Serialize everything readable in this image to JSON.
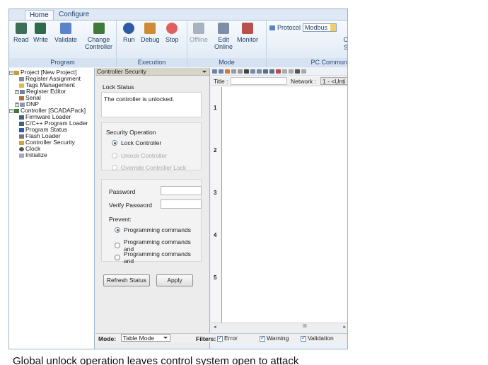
{
  "ribbon": {
    "tabs": [
      "Home",
      "Configure"
    ],
    "groups": {
      "program": {
        "label": "Program",
        "buttons": [
          "Read",
          "Write",
          "Validate",
          "Change",
          "Controller"
        ]
      },
      "execution": {
        "label": "Execution",
        "buttons": [
          "Run",
          "Debug",
          "Stop"
        ]
      },
      "mode": {
        "label": "Mode",
        "buttons": [
          "Offline",
          "Edit",
          "Online",
          "Monitor"
        ]
      },
      "pc_comm": {
        "label": "PC Commun",
        "protocol_label": "Protocol",
        "protocol_value": "Modbus",
        "clipped_1": "C",
        "clipped_2": "S"
      }
    }
  },
  "tree": {
    "items": [
      "Project [New Project]",
      "Register Assignment",
      "Tags Management",
      "Register Editor",
      "Serial",
      "DNP",
      "Controller [SCADAPack]",
      "Firmware Loader",
      "C/C++ Program Loader",
      "Program Status",
      "Flash Loader",
      "Controller Security",
      "Clock",
      "Initialize"
    ]
  },
  "security_panel": {
    "title": "Controller Security",
    "lock_status_label": "Lock Status",
    "lock_status_text": "The controller is unlocked.",
    "operation_label": "Security Operation",
    "op_lock": "Lock Controller",
    "op_unlock": "Unlock Controller",
    "op_override": "Override Controller Lock",
    "password_label": "Password",
    "verify_label": "Verify Password",
    "prevent_label": "Prevent:",
    "prevent_1": "Programming commands",
    "prevent_2": "Programming commands and",
    "prevent_3": "Programming commands and",
    "refresh_button": "Refresh Status",
    "apply_button": "Apply"
  },
  "editor": {
    "title_label": "Title :",
    "network_label": "Network :",
    "network_value": "1 - <Unti",
    "line_numbers": [
      "1",
      "2",
      "3",
      "4",
      "5"
    ],
    "scroll_label": "III"
  },
  "statusbar": {
    "mode_label": "Mode:",
    "mode_value": "Table Mode",
    "filters_label": "Filters:",
    "filter_error": "Error",
    "filter_warning": "Warning",
    "filter_validation": "Validation"
  },
  "caption": "Global unlock operation leaves control system open to attack"
}
